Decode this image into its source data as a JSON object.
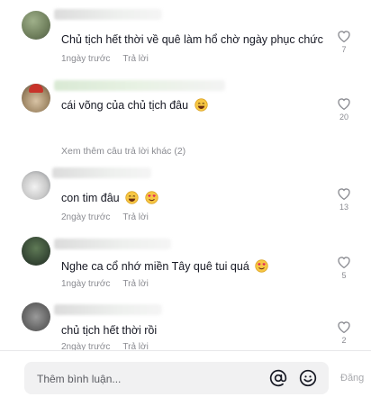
{
  "comments": [
    {
      "text": "Chủ tịch hết thời về quê làm hổ chờ ngày phục chức",
      "time": "1ngày trước",
      "reply": "Trả lời",
      "likes": "7",
      "emojis": []
    },
    {
      "text": "cái võng của chủ tịch đâu",
      "time": "",
      "reply": "",
      "likes": "20",
      "emojis": [
        "grin"
      ],
      "more_replies": "Xem thêm câu trả lời khác (2)"
    },
    {
      "text": "con tim đâu",
      "time": "2ngày trước",
      "reply": "Trả lời",
      "likes": "13",
      "emojis": [
        "grin",
        "love"
      ]
    },
    {
      "text": "Nghe ca cổ nhớ miền Tây quê tui quá",
      "time": "1ngày trước",
      "reply": "Trả lời",
      "likes": "5",
      "emojis": [
        "love"
      ]
    },
    {
      "text": "chủ tịch hết thời rồi",
      "time": "2ngày trước",
      "reply": "Trả lời",
      "likes": "2",
      "emojis": []
    }
  ],
  "input": {
    "placeholder": "Thêm bình luận...",
    "post_label": "Đăng"
  },
  "icons": {
    "like": "heart-outline-icon",
    "mention": "at-sign-icon",
    "emoji": "smiley-icon"
  },
  "colors": {
    "muted": "#8a8b91",
    "input_bg": "#f1f1f2"
  }
}
